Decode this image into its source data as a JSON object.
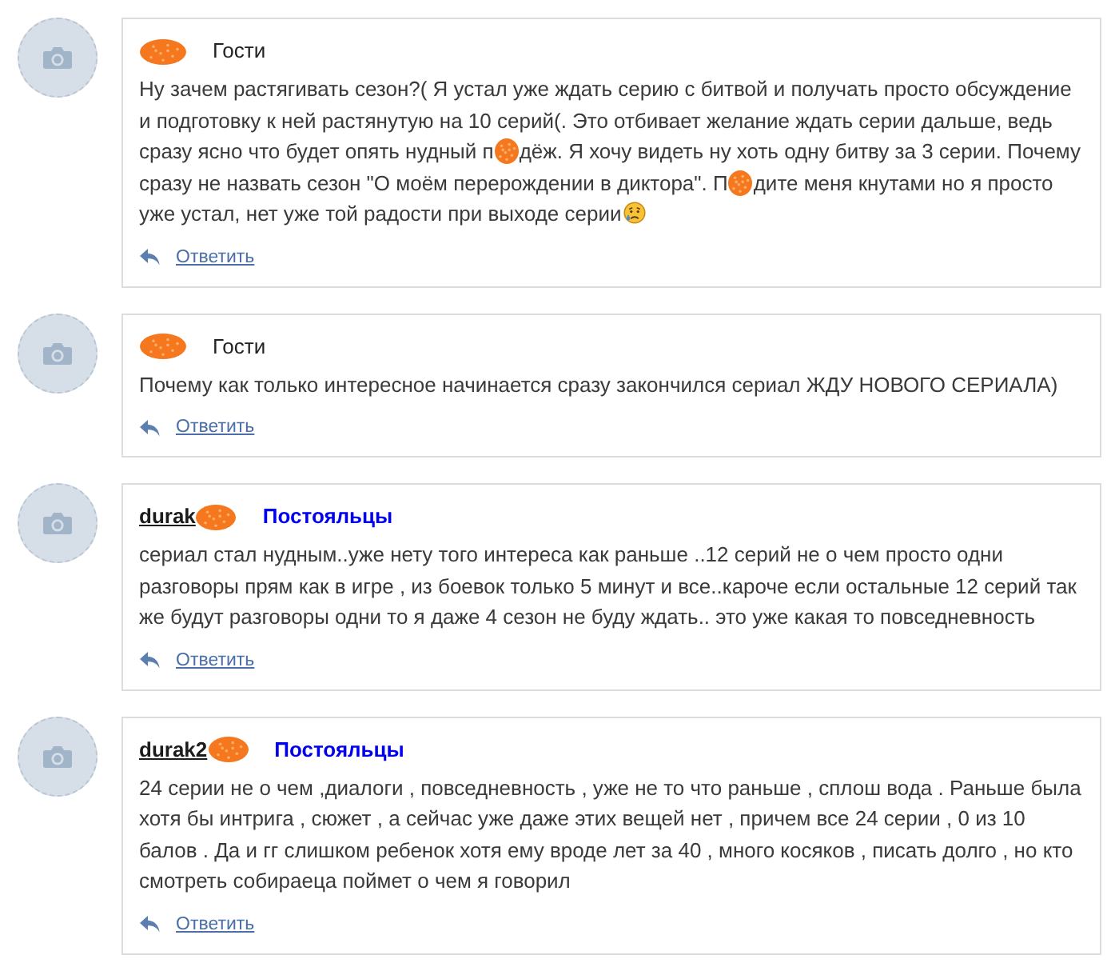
{
  "comments": [
    {
      "author": {
        "redacted": true
      },
      "group": {
        "kind": "guest",
        "label": "Гости"
      },
      "body": [
        {
          "kind": "text",
          "text": "Ну зачем растягивать сезон?( Я устал уже ждать серию с битвой и получать просто обсуждение и подготовку к ней растянутую на 10 серий(. Это отбивает желание ждать серии дальше, ведь сразу ясно что будет опять нудный п"
        },
        {
          "kind": "scribble"
        },
        {
          "kind": "text",
          "text": "дёж. Я хочу видеть ну хоть одну битву за 3 серии. Почему сразу не назвать сезон \"О моём перерождении в диктора\". П"
        },
        {
          "kind": "scribble"
        },
        {
          "kind": "text",
          "text": "дите меня кнутами но я просто уже устал, нет уже той радости при выходе серии"
        },
        {
          "kind": "emoji"
        }
      ],
      "reply": "Ответить"
    },
    {
      "author": {
        "redacted": true
      },
      "group": {
        "kind": "guest",
        "label": "Гости"
      },
      "body": [
        {
          "kind": "text",
          "text": "Почему как только интересное начинается сразу закончился сериал ЖДУ НОВОГО СЕРИАЛА)"
        }
      ],
      "reply": "Ответить"
    },
    {
      "author": {
        "name": "durak",
        "redacted": true
      },
      "group": {
        "kind": "regular",
        "label": "Постояльцы"
      },
      "body": [
        {
          "kind": "text",
          "text": "сериал стал нудным..уже нету того интереса как раньше ..12 серий не о чем просто одни разговоры прям как в игре , из боевок только 5 минут и все..кароче если остальные 12 серий так же будут разговоры одни то я даже 4 сезон не буду ждать.. это уже какая то повседневность"
        }
      ],
      "reply": "Ответить"
    },
    {
      "author": {
        "name": "durak2",
        "redacted": true
      },
      "group": {
        "kind": "regular",
        "label": "Постояльцы"
      },
      "body": [
        {
          "kind": "text",
          "text": "24 серии не о чем ,диалоги , повседневность , уже не то что раньше , сплош вода . Раньше была хотя бы интрига , сюжет , а сейчас уже даже этих вещей нет , причем все 24 серии , 0 из 10 балов . Да и гг слишком ребенок хотя ему вроде лет за 40 , много косяков , писать долго , но кто смотреть собираеца поймет о чем я говорил"
        }
      ],
      "reply": "Ответить"
    }
  ]
}
